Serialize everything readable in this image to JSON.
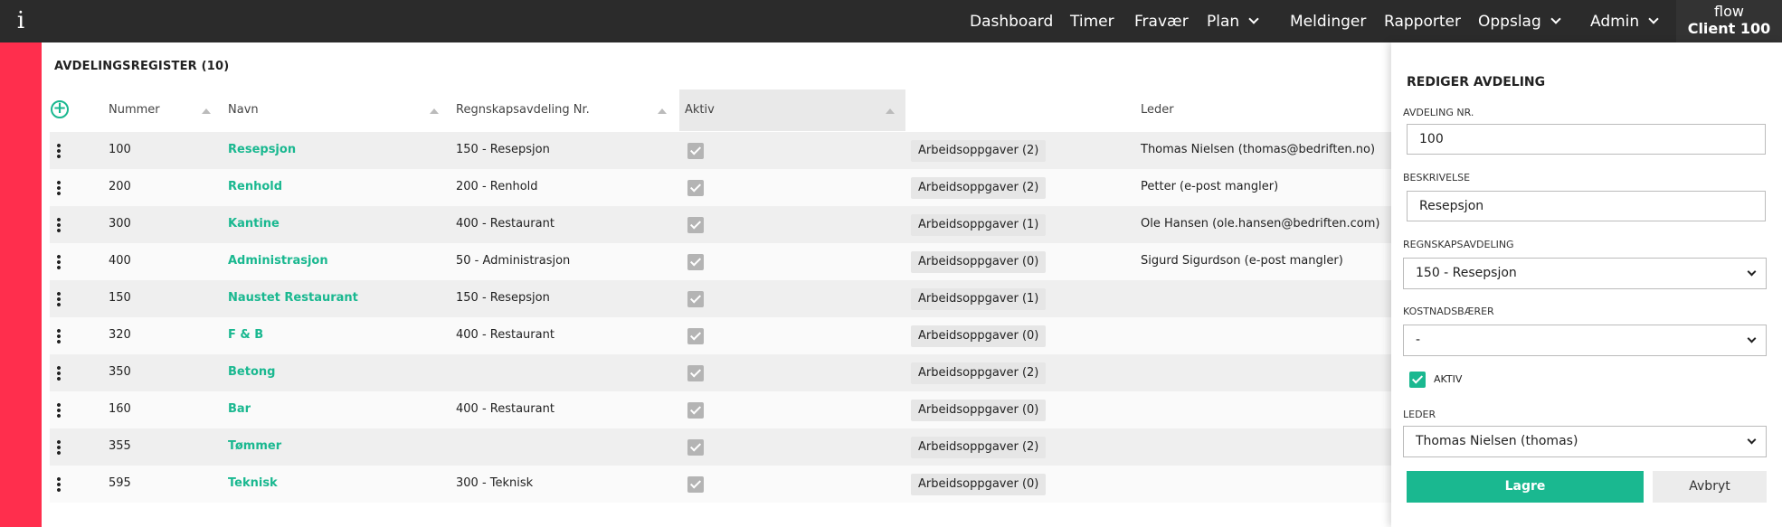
{
  "topbar": {
    "info_label": "i",
    "nav": [
      {
        "label": "Dashboard",
        "has_menu": false
      },
      {
        "label": "Timer",
        "has_menu": false
      },
      {
        "label": "Fravær",
        "has_menu": false
      },
      {
        "label": "Plan",
        "has_menu": true
      },
      {
        "label": "Meldinger",
        "has_menu": false
      },
      {
        "label": "Rapporter",
        "has_menu": false
      },
      {
        "label": "Oppslag",
        "has_menu": true
      },
      {
        "label": "Admin",
        "has_menu": true
      }
    ],
    "client_line1": "flow",
    "client_line2": "Client 100"
  },
  "list": {
    "title": "AVDELINGSREGISTER (10)",
    "add_icon": "plus-circle-icon",
    "columns": {
      "nummer": "Nummer",
      "navn": "Navn",
      "regnskap": "Regnskapsavdeling Nr.",
      "aktiv": "Aktiv",
      "leder": "Leder"
    },
    "rows": [
      {
        "nummer": "100",
        "navn": "Resepsjon",
        "regnskap": "150 - Resepsjon",
        "aktiv": true,
        "oppgaver": "Arbeidsoppgaver (2)",
        "leder": "Thomas Nielsen (thomas@bedriften.no)"
      },
      {
        "nummer": "200",
        "navn": "Renhold",
        "regnskap": "200 - Renhold",
        "aktiv": true,
        "oppgaver": "Arbeidsoppgaver (2)",
        "leder": "Petter (e-post mangler)"
      },
      {
        "nummer": "300",
        "navn": "Kantine",
        "regnskap": "400 - Restaurant",
        "aktiv": true,
        "oppgaver": "Arbeidsoppgaver (1)",
        "leder": "Ole Hansen (ole.hansen@bedriften.com)"
      },
      {
        "nummer": "400",
        "navn": "Administrasjon",
        "regnskap": "50 - Administrasjon",
        "aktiv": true,
        "oppgaver": "Arbeidsoppgaver (0)",
        "leder": "Sigurd Sigurdson (e-post mangler)"
      },
      {
        "nummer": "150",
        "navn": "Naustet Restaurant",
        "regnskap": "150 - Resepsjon",
        "aktiv": true,
        "oppgaver": "Arbeidsoppgaver (1)",
        "leder": ""
      },
      {
        "nummer": "320",
        "navn": "F & B",
        "regnskap": "400 - Restaurant",
        "aktiv": true,
        "oppgaver": "Arbeidsoppgaver (0)",
        "leder": ""
      },
      {
        "nummer": "350",
        "navn": "Betong",
        "regnskap": "",
        "aktiv": true,
        "oppgaver": "Arbeidsoppgaver (2)",
        "leder": ""
      },
      {
        "nummer": "160",
        "navn": "Bar",
        "regnskap": "400 - Restaurant",
        "aktiv": true,
        "oppgaver": "Arbeidsoppgaver (0)",
        "leder": ""
      },
      {
        "nummer": "355",
        "navn": "Tømmer",
        "regnskap": "",
        "aktiv": true,
        "oppgaver": "Arbeidsoppgaver (2)",
        "leder": ""
      },
      {
        "nummer": "595",
        "navn": "Teknisk",
        "regnskap": "300 - Teknisk",
        "aktiv": true,
        "oppgaver": "Arbeidsoppgaver (0)",
        "leder": ""
      }
    ]
  },
  "panel": {
    "title": "REDIGER AVDELING",
    "avdeling_label": "AVDELING NR.",
    "avdeling_value": "100",
    "beskrivelse_label": "BESKRIVELSE",
    "beskrivelse_value": "Resepsjon",
    "regnskap_label": "REGNSKAPSAVDELING",
    "regnskap_value": "150 - Resepsjon",
    "kostnad_label": "KOSTNADSBÆRER",
    "kostnad_value": "-",
    "aktiv_label": "AKTIV",
    "aktiv_checked": true,
    "leder_label": "LEDER",
    "leder_value": "Thomas Nielsen (thomas)",
    "save_label": "Lagre",
    "cancel_label": "Avbryt"
  },
  "colors": {
    "accent": "#1ab890",
    "sidebar": "#ff2e4d",
    "topbar": "#2b2b2b"
  }
}
